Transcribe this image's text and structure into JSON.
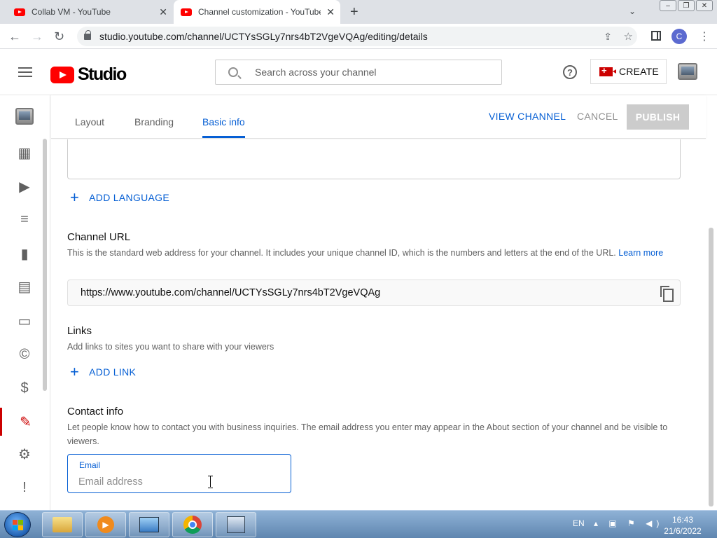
{
  "browser": {
    "tabs": [
      {
        "title": "Collab VM - YouTube"
      },
      {
        "title": "Channel customization - YouTube Studio"
      }
    ],
    "url": "studio.youtube.com/channel/UCTYsSGLy7nrs4bT2VgeVQAg/editing/details",
    "profile_initial": "C"
  },
  "header": {
    "logo_text": "Studio",
    "search_placeholder": "Search across your channel",
    "help_glyph": "?",
    "create_label": "CREATE"
  },
  "subnav": {
    "tabs": [
      {
        "label": "Layout"
      },
      {
        "label": "Branding"
      },
      {
        "label": "Basic info"
      }
    ],
    "view_channel": "VIEW CHANNEL",
    "cancel": "CANCEL",
    "publish": "PUBLISH"
  },
  "content": {
    "add_language": "ADD LANGUAGE",
    "channel_url": {
      "title": "Channel URL",
      "description": "This is the standard web address for your channel. It includes your unique channel ID, which is the numbers and letters at the end of the URL.",
      "learn_more": "Learn more",
      "value": "https://www.youtube.com/channel/UCTYsSGLy7nrs4bT2VgeVQAg"
    },
    "links": {
      "title": "Links",
      "description": "Add links to sites you want to share with your viewers",
      "add_link": "ADD LINK"
    },
    "contact": {
      "title": "Contact info",
      "description": "Let people know how to contact you with business inquiries. The email address you enter may appear in the About section of your channel and be visible to viewers.",
      "email_label": "Email",
      "email_placeholder": "Email address",
      "email_value": ""
    }
  },
  "taskbar": {
    "lang": "EN",
    "time": "16:43",
    "date": "21/6/2022"
  },
  "colors": {
    "accent_blue": "#065fd4",
    "youtube_red": "#ff0000",
    "active_rail": "#cc0000"
  }
}
